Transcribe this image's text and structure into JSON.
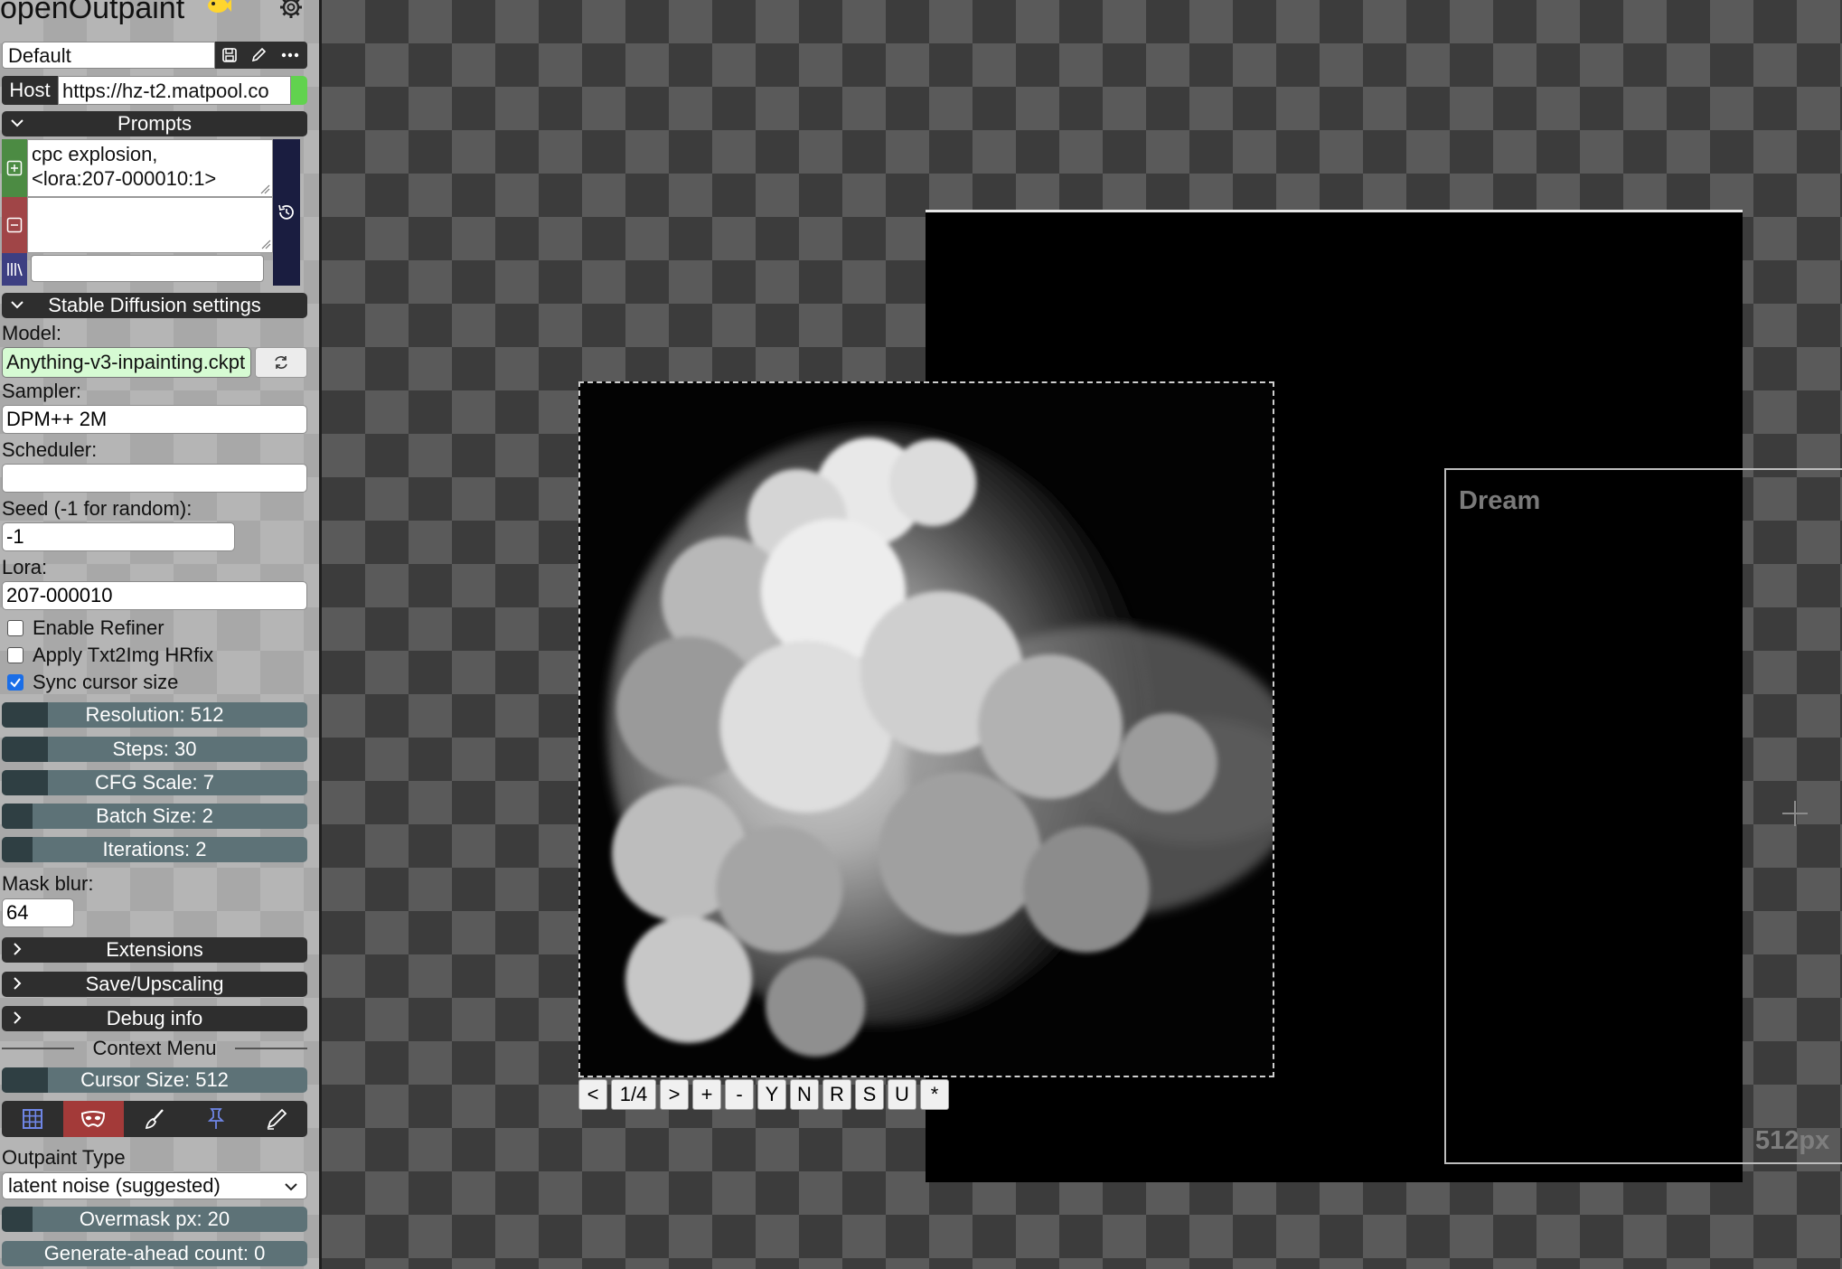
{
  "app": {
    "title": "openOutpaint"
  },
  "preset": {
    "selected": "Default"
  },
  "host": {
    "label": "Host",
    "value": "https://hz-t2.matpool.co",
    "status_color": "#61d24e"
  },
  "prompts": {
    "section_label": "Prompts",
    "positive_line1": "cpc explosion,",
    "positive_line2": "<lora:207-000010:1>",
    "negative": "",
    "style": ""
  },
  "sd_settings": {
    "section_label": "Stable Diffusion settings",
    "model_label": "Model:",
    "model_value": "Anything-v3-inpainting.ckpt",
    "sampler_label": "Sampler:",
    "sampler_value": "DPM++ 2M",
    "scheduler_label": "Scheduler:",
    "scheduler_value": "",
    "seed_label": "Seed (-1 for random):",
    "seed_value": "-1",
    "lora_label": "Lora:",
    "lora_value": "207-000010",
    "enable_refiner_label": "Enable Refiner",
    "enable_refiner_checked": false,
    "hrfix_label": "Apply Txt2Img HRfix",
    "hrfix_checked": false,
    "sync_cursor_label": "Sync cursor size",
    "sync_cursor_checked": true,
    "resolution_label": "Resolution: 512",
    "resolution_fraction": 0.15,
    "steps_label": "Steps: 30",
    "steps_fraction": 0.15,
    "cfg_label": "CFG Scale: 7",
    "cfg_fraction": 0.15,
    "batch_label": "Batch Size: 2",
    "batch_fraction": 0.1,
    "iterations_label": "Iterations: 2",
    "iterations_fraction": 0.1,
    "mask_blur_label": "Mask blur:",
    "mask_blur_value": "64"
  },
  "sections": {
    "extensions": "Extensions",
    "save_upscaling": "Save/Upscaling",
    "debug_info": "Debug info"
  },
  "context_menu": {
    "label": "Context Menu",
    "cursor_size_label": "Cursor Size: 512",
    "cursor_size_fraction": 0.15,
    "tools": [
      "grid-icon",
      "mask-icon",
      "brush-icon",
      "stamp-icon",
      "pen-icon"
    ],
    "active_tool_color": "#a33a39",
    "outpaint_type_label": "Outpaint Type",
    "outpaint_type_value": "latent noise (suggested)",
    "overmask_label": "Overmask px: 20",
    "overmask_fraction": 0.1,
    "generate_ahead_label": "Generate-ahead count: 0",
    "generate_ahead_fraction": 0.0
  },
  "canvas": {
    "dream_label": "Dream",
    "size_label": "512px",
    "nav": {
      "prev": "<",
      "counter": "1/4",
      "next": ">",
      "plus": "+",
      "minus": "-",
      "yes": "Y",
      "no": "N",
      "regenerate": "R",
      "save": "S",
      "upscale": "U",
      "star": "*"
    }
  }
}
